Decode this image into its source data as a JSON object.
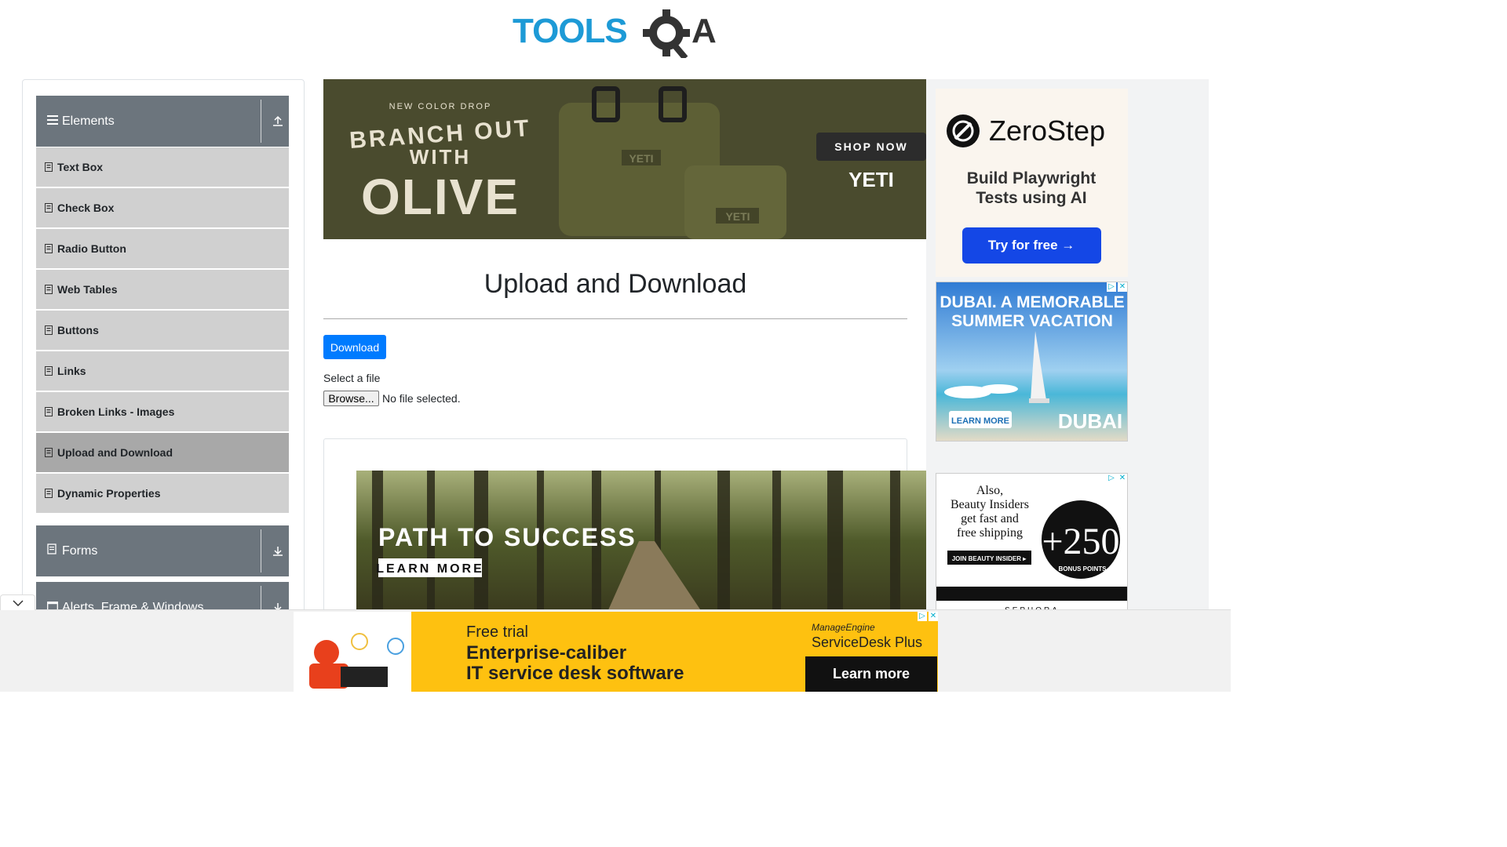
{
  "logo": {
    "text_tools": "TOOLS",
    "text_qa": "QA"
  },
  "sidebar": {
    "groups": [
      {
        "title": "Elements",
        "icon": "menu-icon",
        "arrow": "collapse-up-icon"
      },
      {
        "title": "Forms",
        "icon": "document-icon",
        "arrow": "expand-down-icon"
      },
      {
        "title": "Alerts, Frame & Windows",
        "icon": "window-icon",
        "arrow": "expand-down-icon"
      }
    ],
    "items": [
      {
        "label": "Text Box"
      },
      {
        "label": "Check Box"
      },
      {
        "label": "Radio Button"
      },
      {
        "label": "Web Tables"
      },
      {
        "label": "Buttons"
      },
      {
        "label": "Links"
      },
      {
        "label": "Broken Links - Images"
      },
      {
        "label": "Upload and Download"
      },
      {
        "label": "Dynamic Properties"
      }
    ],
    "active_item": "Upload and Download"
  },
  "main": {
    "title": "Upload and Download",
    "download_label": "Download",
    "select_label": "Select a file",
    "browse_label": "Browse...",
    "no_file_text": "No file selected."
  },
  "ads": {
    "yeti": {
      "kicker": "NEW COLOR DROP",
      "line1": "BRANCH OUT",
      "line2": "WITH",
      "line3": "OLIVE",
      "cta": "SHOP NOW",
      "brand": "YETI",
      "bag1": "YETI",
      "bag2": "YETI"
    },
    "forest": {
      "headline": "PATH TO SUCCESS",
      "cta": "LEARN MORE"
    },
    "zerostep": {
      "brand": "ZeroStep",
      "line1": "Build Playwright",
      "line2": "Tests using AI",
      "cta": "Try for free →"
    },
    "dubai": {
      "line1": "DUBAI. A MEMORABLE",
      "line2": "SUMMER VACATION",
      "cta": "LEARN MORE",
      "brand": "DUBAI"
    },
    "sephora": {
      "line1": "Also,",
      "line2": "Beauty Insiders",
      "line3": "get fast and",
      "line4": "free shipping",
      "cta": "JOIN BEAUTY INSIDER ▸",
      "points": "+250",
      "points_label": "BONUS POINTS",
      "brand": "SEPHORA"
    },
    "servicedesk": {
      "line1": "Free trial",
      "line2": "Enterprise-caliber",
      "line3": "IT service desk software",
      "brand_small": "ManageEngine",
      "brand": "ServiceDesk Plus",
      "cta": "Learn more"
    }
  },
  "colors": {
    "primary": "#007bff",
    "sidebar_header": "#6c757d",
    "menu_item": "#d0d0d0",
    "active_item": "#a8a8a8",
    "logo_blue": "#1d9ad6",
    "logo_dark": "#333333"
  }
}
